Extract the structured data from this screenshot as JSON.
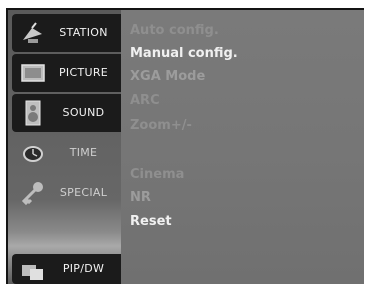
{
  "sidebar": {
    "items": [
      {
        "label": "STATION",
        "icon": "satellite-dish-icon"
      },
      {
        "label": "PICTURE",
        "icon": "picture-frame-icon"
      },
      {
        "label": "SOUND",
        "icon": "speaker-icon"
      },
      {
        "label": "TIME",
        "icon": "clock-icon"
      },
      {
        "label": "SPECIAL",
        "icon": "key-icon"
      },
      {
        "label": "PIP/DW",
        "icon": "pip-icon"
      }
    ]
  },
  "menu": {
    "items": [
      {
        "label": "Auto config."
      },
      {
        "label": "Manual config."
      },
      {
        "label": "XGA Mode"
      },
      {
        "label": "ARC"
      },
      {
        "label": "Zoom+/-"
      },
      {
        "label": ""
      },
      {
        "label": "Cinema"
      },
      {
        "label": "NR"
      },
      {
        "label": "Reset"
      }
    ]
  }
}
